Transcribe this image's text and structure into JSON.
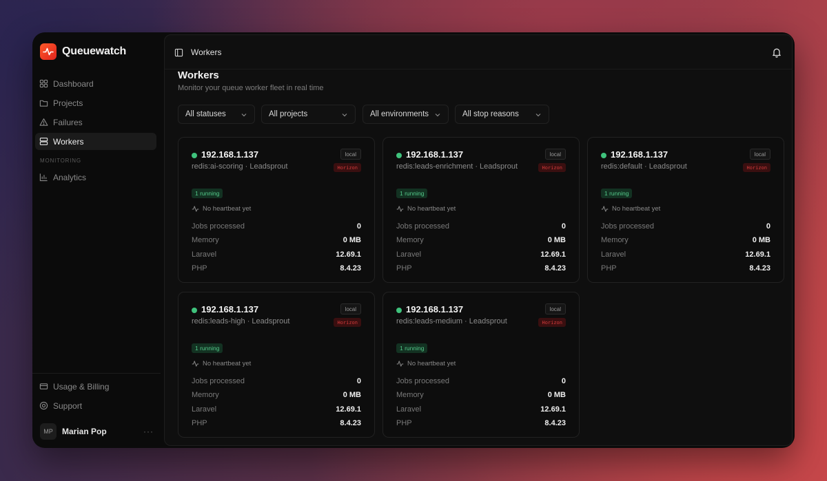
{
  "app": {
    "name": "Queuewatch"
  },
  "sidebar": {
    "items": [
      {
        "label": "Dashboard",
        "icon": "grid-icon"
      },
      {
        "label": "Projects",
        "icon": "folder-icon"
      },
      {
        "label": "Failures",
        "icon": "warning-icon"
      },
      {
        "label": "Workers",
        "icon": "server-icon",
        "active": true
      }
    ],
    "section": "MONITORING",
    "monitoring_items": [
      {
        "label": "Analytics",
        "icon": "bar-chart-icon"
      }
    ],
    "bottom_items": [
      {
        "label": "Usage & Billing",
        "icon": "credit-card-icon"
      },
      {
        "label": "Support",
        "icon": "help-circle-icon"
      }
    ],
    "user": {
      "initials": "MP",
      "name": "Marian Pop",
      "more": "···"
    }
  },
  "header": {
    "breadcrumb": "Workers"
  },
  "page": {
    "title": "Workers",
    "subtitle": "Monitor your queue worker fleet in real time"
  },
  "filters": [
    {
      "label": "All statuses"
    },
    {
      "label": "All projects"
    },
    {
      "label": "All environments"
    },
    {
      "label": "All stop reasons"
    }
  ],
  "workers": [
    {
      "ip": "192.168.1.137",
      "queue": "redis:ai-scoring · Leadsprout",
      "env": "local",
      "supervisor": "Horizon",
      "status": "1 running",
      "heartbeat": "No heartbeat yet",
      "jobs_label": "Jobs processed",
      "jobs": "0",
      "memory_label": "Memory",
      "memory": "0 MB",
      "laravel_label": "Laravel",
      "laravel": "12.69.1",
      "php_label": "PHP",
      "php": "8.4.23"
    },
    {
      "ip": "192.168.1.137",
      "queue": "redis:leads-enrichment · Leadsprout",
      "env": "local",
      "supervisor": "Horizon",
      "status": "1 running",
      "heartbeat": "No heartbeat yet",
      "jobs_label": "Jobs processed",
      "jobs": "0",
      "memory_label": "Memory",
      "memory": "0 MB",
      "laravel_label": "Laravel",
      "laravel": "12.69.1",
      "php_label": "PHP",
      "php": "8.4.23"
    },
    {
      "ip": "192.168.1.137",
      "queue": "redis:default · Leadsprout",
      "env": "local",
      "supervisor": "Horizon",
      "status": "1 running",
      "heartbeat": "No heartbeat yet",
      "jobs_label": "Jobs processed",
      "jobs": "0",
      "memory_label": "Memory",
      "memory": "0 MB",
      "laravel_label": "Laravel",
      "laravel": "12.69.1",
      "php_label": "PHP",
      "php": "8.4.23"
    },
    {
      "ip": "192.168.1.137",
      "queue": "redis:leads-high · Leadsprout",
      "env": "local",
      "supervisor": "Horizon",
      "status": "1 running",
      "heartbeat": "No heartbeat yet",
      "jobs_label": "Jobs processed",
      "jobs": "0",
      "memory_label": "Memory",
      "memory": "0 MB",
      "laravel_label": "Laravel",
      "laravel": "12.69.1",
      "php_label": "PHP",
      "php": "8.4.23"
    },
    {
      "ip": "192.168.1.137",
      "queue": "redis:leads-medium · Leadsprout",
      "env": "local",
      "supervisor": "Horizon",
      "status": "1 running",
      "heartbeat": "No heartbeat yet",
      "jobs_label": "Jobs processed",
      "jobs": "0",
      "memory_label": "Memory",
      "memory": "0 MB",
      "laravel_label": "Laravel",
      "laravel": "12.69.1",
      "php_label": "PHP",
      "php": "8.4.23"
    }
  ],
  "colors": {
    "accent": "#e63b24",
    "online": "#3fc27c",
    "horizon": "#d13a3a"
  }
}
